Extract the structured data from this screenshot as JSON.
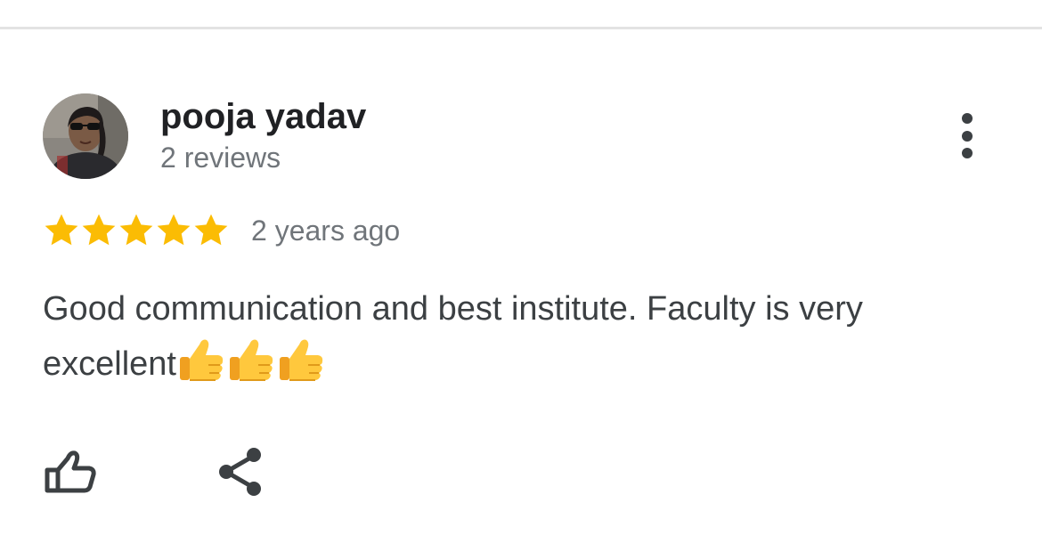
{
  "review": {
    "author": {
      "name": "pooja yadav",
      "review_count": "2 reviews",
      "avatar_icon": "profile-photo"
    },
    "rating": {
      "stars": 5,
      "max_stars": 5,
      "color": "#fbbc04"
    },
    "date": "2 years ago",
    "text": "Good communication and best institute. Faculty is very excellent",
    "emojis": [
      "👍",
      "👍",
      "👍"
    ],
    "actions": {
      "more_icon": "more-vertical-icon",
      "like_icon": "thumb-up-icon",
      "share_icon": "share-icon"
    }
  },
  "colors": {
    "name": "#202124",
    "secondary": "#70757a",
    "body_text": "#3c4043",
    "icon": "#3c4043",
    "divider": "#e3e3e3"
  }
}
